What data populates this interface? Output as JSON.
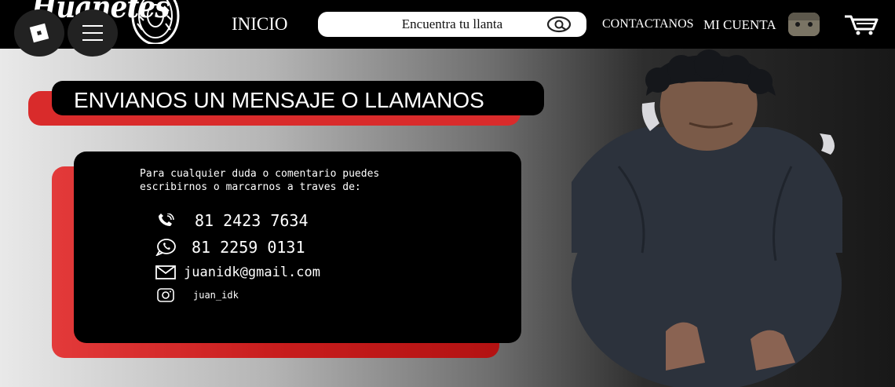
{
  "header": {
    "logo_text": "Huanetes",
    "nav_home": "INICIO",
    "search": {
      "placeholder": "Encuentra tu llanta"
    },
    "nav_contact": "CONTACTANOS",
    "nav_account": "MI CUENTA",
    "icons": [
      "roblox-logo-icon",
      "hamburger-menu-icon",
      "search-icon",
      "avatar",
      "cart-icon"
    ]
  },
  "main": {
    "title": "ENVIANOS UN MENSAJE O LLAMANOS",
    "intro": "Para cualquier duda o comentario puedes escribirnos o marcarnos a traves de:",
    "contacts": {
      "phone": "81 2423 7634",
      "whatsapp": "81 2259 0131",
      "email": "juanidk@gmail.com",
      "instagram": "juan_idk"
    }
  },
  "colors": {
    "header_bg": "#000000",
    "accent_red": "#d92b2b",
    "card_bg": "#000000",
    "text": "#ffffff"
  }
}
